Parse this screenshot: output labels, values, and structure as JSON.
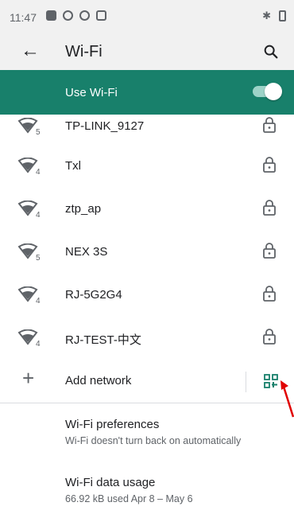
{
  "status_bar": {
    "time": "11:47"
  },
  "app_bar": {
    "title": "Wi-Fi"
  },
  "use_wifi": {
    "label": "Use Wi-Fi",
    "enabled": true
  },
  "networks": [
    {
      "name": "TP-LINK_9127",
      "band": "5",
      "secured": true
    },
    {
      "name": "Txl",
      "band": "4",
      "secured": true
    },
    {
      "name": "ztp_ap",
      "band": "4",
      "secured": true
    },
    {
      "name": "NEX 3S",
      "band": "5",
      "secured": true
    },
    {
      "name": "RJ-5G2G4",
      "band": "4",
      "secured": true
    },
    {
      "name": "RJ-TEST-中文",
      "band": "4",
      "secured": true
    }
  ],
  "add_network": {
    "label": "Add network"
  },
  "preferences": {
    "title": "Wi-Fi preferences",
    "subtitle": "Wi-Fi doesn't turn back on automatically"
  },
  "data_usage": {
    "title": "Wi-Fi data usage",
    "subtitle": "66.92 kB used Apr 8 – May 6"
  },
  "colors": {
    "accent": "#18806b",
    "annotation_arrow": "#e00000"
  }
}
